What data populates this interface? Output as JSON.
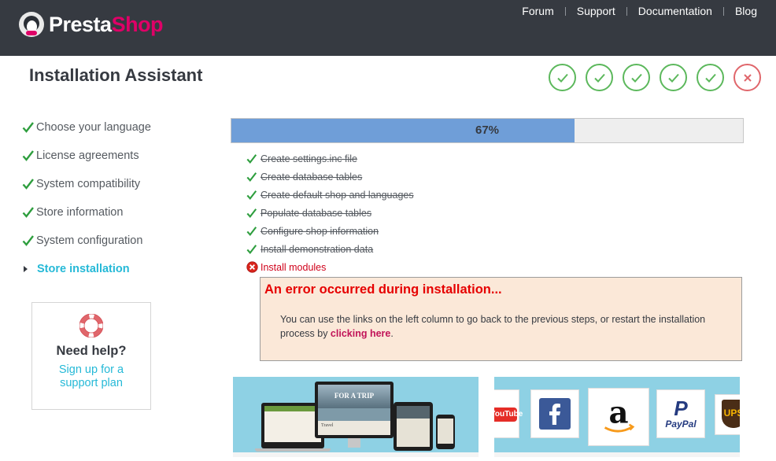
{
  "header": {
    "logo": {
      "part1": "Presta",
      "part2": "Shop"
    },
    "nav": [
      "Forum",
      "Support",
      "Documentation",
      "Blog"
    ]
  },
  "page": {
    "title": "Installation Assistant"
  },
  "steps": {
    "completed": 5,
    "total": 6,
    "last_status": "error"
  },
  "sidebar": {
    "items": [
      {
        "label": "Choose your language",
        "status": "done"
      },
      {
        "label": "License agreements",
        "status": "done"
      },
      {
        "label": "System compatibility",
        "status": "done"
      },
      {
        "label": "Store information",
        "status": "done"
      },
      {
        "label": "System configuration",
        "status": "done"
      },
      {
        "label": "Store installation",
        "status": "current"
      }
    ],
    "help": {
      "title": "Need help?",
      "link": "Sign up for a support plan"
    }
  },
  "progress": {
    "percent": 67,
    "label": "67%"
  },
  "tasks": [
    {
      "label": "Create settings.inc file",
      "status": "done"
    },
    {
      "label": "Create database tables",
      "status": "done"
    },
    {
      "label": "Create default shop and languages",
      "status": "done"
    },
    {
      "label": "Populate database tables",
      "status": "done"
    },
    {
      "label": "Configure shop information",
      "status": "done"
    },
    {
      "label": "Install demonstration data",
      "status": "done"
    },
    {
      "label": "Install modules",
      "status": "failed"
    }
  ],
  "error": {
    "title": "An error occurred during installation...",
    "body": "You can use the links on the left column to go back to the previous steps, or restart the installation process by ",
    "link": "clicking here",
    "suffix": "."
  },
  "promos": {
    "themes": {
      "screen_text": "FOR A TRIP",
      "caption": "Travel"
    },
    "modules": {
      "logos": [
        "YouTube",
        "Facebook",
        "Amazon",
        "PayPal",
        "UPS"
      ]
    }
  },
  "colors": {
    "header_bg": "#363a41",
    "brand_pink": "#df0067",
    "accent_cyan": "#25b9d7",
    "success_green": "#5cb85c",
    "error_red": "#e60000",
    "progress_blue": "#6f9ed8"
  }
}
